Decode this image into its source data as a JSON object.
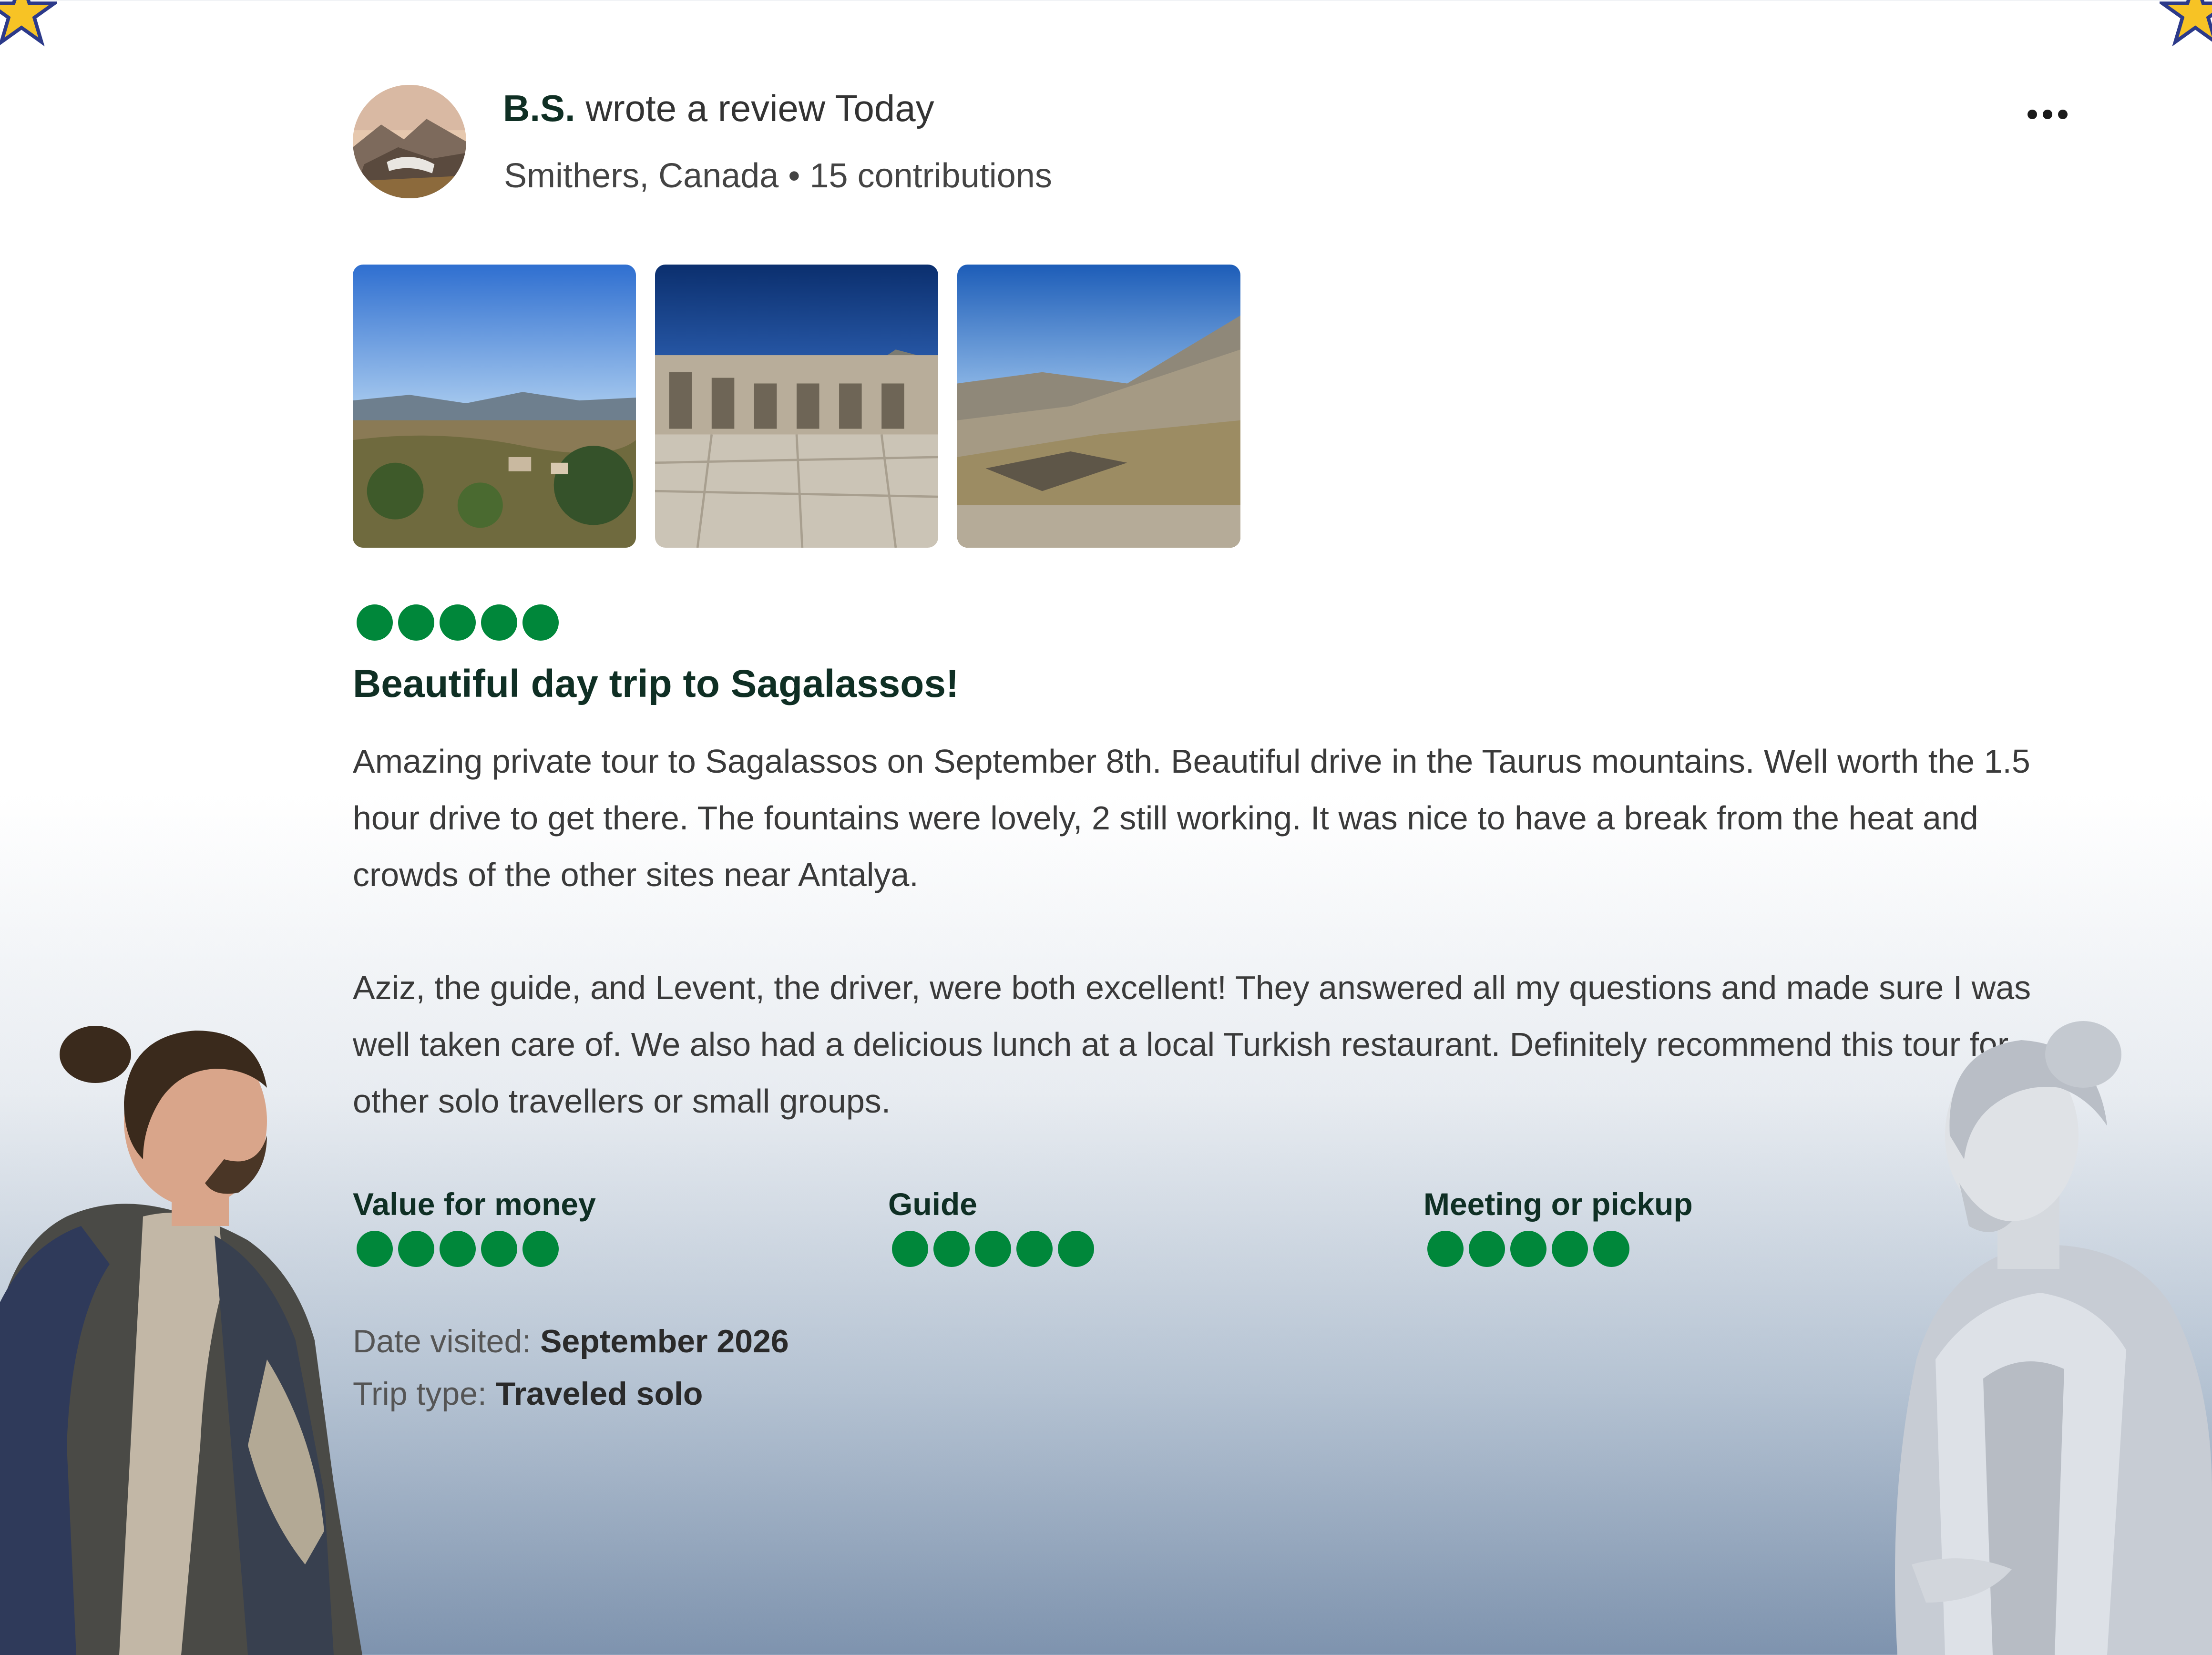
{
  "review": {
    "author": "B.S.",
    "action": " wrote a review ",
    "when": "Today",
    "location_line": "Smithers, Canada • 15 contributions",
    "rating": 5,
    "title": "Beautiful day trip to Sagalassos!",
    "paragraph_1": "Amazing private tour to Sagalassos on September 8th. Beautiful drive in the Taurus mountains. Well worth the 1.5 hour drive to get there. The fountains were lovely, 2 still working. It was nice to have a break from the heat and crowds of the other sites near Antalya.",
    "paragraph_2": "Aziz, the guide, and Levent, the driver, were both excellent! They answered all my questions and made sure I was well taken care of. We also had a delicious lunch at a local Turkish restaurant. Definitely recommend this tour for other solo travellers or small groups.",
    "sub_ratings": [
      {
        "label": "Value for money",
        "rating": 5
      },
      {
        "label": "Guide",
        "rating": 5
      },
      {
        "label": "Meeting or pickup",
        "rating": 5
      }
    ],
    "date_visited_label": "Date visited: ",
    "date_visited_value": "September 2026",
    "trip_type_label": "Trip type: ",
    "trip_type_value": "Traveled solo"
  },
  "icons": {
    "more": "more-horizontal-icon",
    "corner": "star-icon"
  },
  "colors": {
    "bubble_green": "#00873a",
    "heading_dark_green": "#0f2f24",
    "star_yellow": "#f7c325",
    "star_outline": "#2c3a8a"
  }
}
